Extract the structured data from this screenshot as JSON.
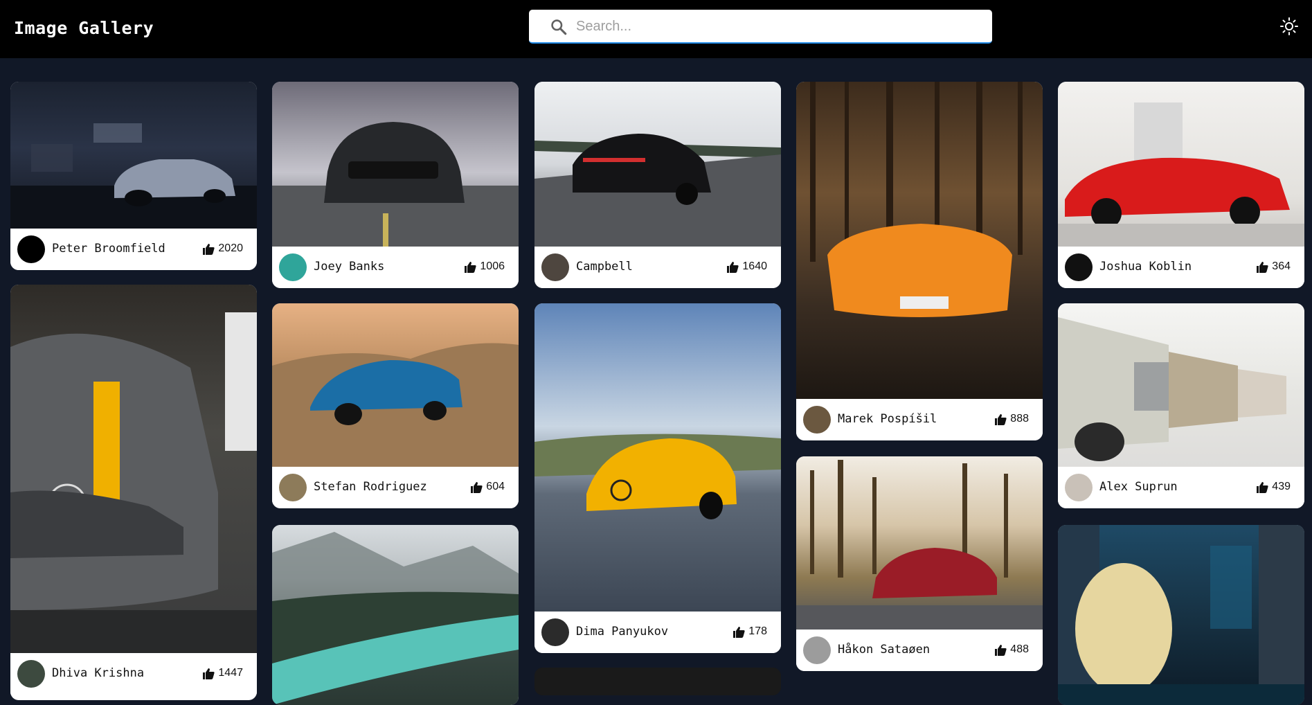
{
  "header": {
    "title": "Image Gallery",
    "search_placeholder": "Search...",
    "search_value": "",
    "search_icon": "search-icon",
    "theme_icon": "sun-icon"
  },
  "colors": {
    "header_bg": "#000000",
    "page_bg": "#111827",
    "card_bg": "#ffffff",
    "search_underline": "#1e88e5"
  },
  "cards": [
    {
      "user": "Peter Broomfield",
      "likes": "2020"
    },
    {
      "user": "Dhiva Krishna",
      "likes": "1447"
    },
    {
      "user": "Joey Banks",
      "likes": "1006"
    },
    {
      "user": "Stefan Rodriguez",
      "likes": "604"
    },
    {
      "user": "Campbell",
      "likes": "1640"
    },
    {
      "user": "Dima Panyukov",
      "likes": "178"
    },
    {
      "user": "Marek Pospíšil",
      "likes": "888"
    },
    {
      "user": "Håkon Sataøen",
      "likes": "488"
    },
    {
      "user": "Joshua Koblin",
      "likes": "364"
    },
    {
      "user": "Alex Suprun",
      "likes": "439"
    }
  ]
}
